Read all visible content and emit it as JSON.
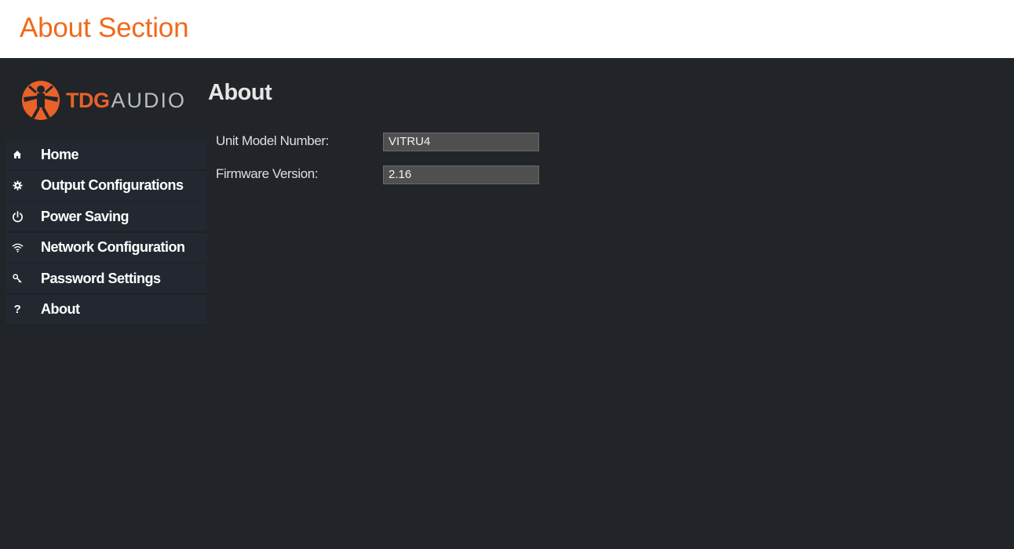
{
  "doc_header": {
    "title": "About Section",
    "title_color": "#f06a1b"
  },
  "logo": {
    "brand_part1": "TDG",
    "brand_part2": "AUDIO",
    "icon": "vitruvian-man-logo-icon",
    "accent_color": "#e8622a"
  },
  "sidebar": {
    "items": [
      {
        "label": "Home",
        "icon": "home-icon"
      },
      {
        "label": "Output Configurations",
        "icon": "gear-icon"
      },
      {
        "label": "Power Saving",
        "icon": "power-icon"
      },
      {
        "label": "Network Configuration",
        "icon": "wifi-icon"
      },
      {
        "label": "Password Settings",
        "icon": "key-icon"
      },
      {
        "label": "About",
        "icon": "question-icon"
      }
    ]
  },
  "main": {
    "title": "About",
    "fields": [
      {
        "label": "Unit Model Number:",
        "value": "VITRU4"
      },
      {
        "label": "Firmware Version:",
        "value": "2.16"
      }
    ]
  },
  "colors": {
    "background": "#212428",
    "sidebar_item_bg": "#232830",
    "field_bg": "#4f4f4f"
  }
}
